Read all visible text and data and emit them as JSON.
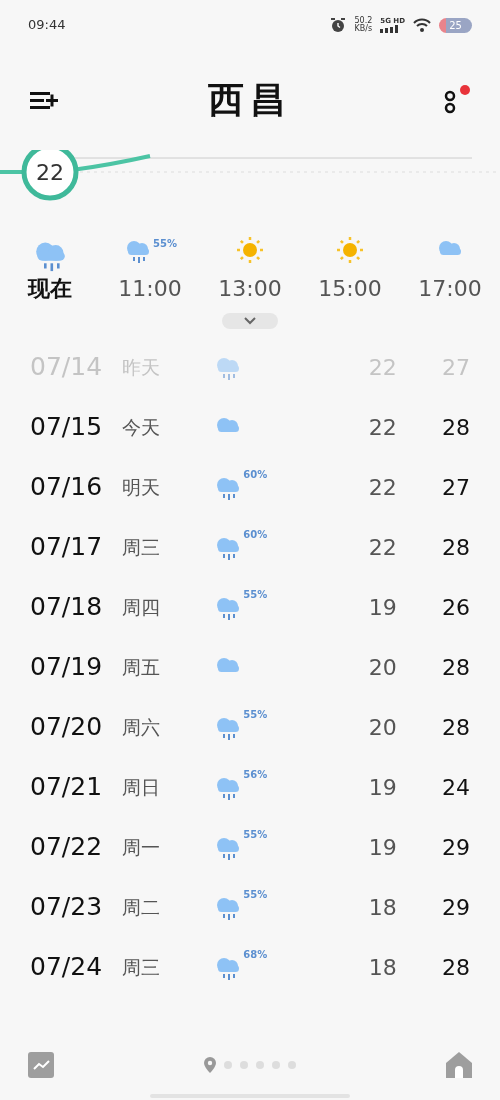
{
  "status_bar": {
    "time": "09:44",
    "speed": "50.2",
    "speed_unit": "KB/s",
    "network": "5G HD",
    "battery": "25"
  },
  "header": {
    "title": "西昌",
    "has_notification": true
  },
  "chart": {
    "current_temp": "22"
  },
  "hourly": [
    {
      "time": "现在",
      "kind": "rain",
      "current": true
    },
    {
      "time": "11:00",
      "kind": "rain",
      "precip": "55%",
      "current": false
    },
    {
      "time": "13:00",
      "kind": "sun",
      "current": false
    },
    {
      "time": "15:00",
      "kind": "sun",
      "current": false
    },
    {
      "time": "17:00",
      "kind": "cloud",
      "current": false
    }
  ],
  "daily": [
    {
      "date": "07/14",
      "day": "昨天",
      "kind": "rain",
      "low": "22",
      "high": "27",
      "past": true
    },
    {
      "date": "07/15",
      "day": "今天",
      "kind": "cloud",
      "low": "22",
      "high": "28",
      "past": false
    },
    {
      "date": "07/16",
      "day": "明天",
      "kind": "rain",
      "precip": "60%",
      "low": "22",
      "high": "27",
      "past": false
    },
    {
      "date": "07/17",
      "day": "周三",
      "kind": "rain",
      "precip": "60%",
      "low": "22",
      "high": "28",
      "past": false
    },
    {
      "date": "07/18",
      "day": "周四",
      "kind": "rain",
      "precip": "55%",
      "low": "19",
      "high": "26",
      "past": false
    },
    {
      "date": "07/19",
      "day": "周五",
      "kind": "cloud",
      "low": "20",
      "high": "28",
      "past": false
    },
    {
      "date": "07/20",
      "day": "周六",
      "kind": "rain",
      "precip": "55%",
      "low": "20",
      "high": "28",
      "past": false
    },
    {
      "date": "07/21",
      "day": "周日",
      "kind": "rain",
      "precip": "56%",
      "low": "19",
      "high": "24",
      "past": false
    },
    {
      "date": "07/22",
      "day": "周一",
      "kind": "rain",
      "precip": "55%",
      "low": "19",
      "high": "29",
      "past": false
    },
    {
      "date": "07/23",
      "day": "周二",
      "kind": "rain",
      "precip": "55%",
      "low": "18",
      "high": "29",
      "past": false
    },
    {
      "date": "07/24",
      "day": "周三",
      "kind": "rain",
      "precip": "68%",
      "low": "18",
      "high": "28",
      "past": false
    }
  ],
  "pages": [
    {
      "kind": "location",
      "selected": false
    },
    {
      "kind": "dot",
      "selected": false
    },
    {
      "kind": "dot",
      "selected": false
    },
    {
      "kind": "dot",
      "selected": false
    },
    {
      "kind": "dot",
      "selected": false
    },
    {
      "kind": "dot",
      "selected": false
    }
  ]
}
